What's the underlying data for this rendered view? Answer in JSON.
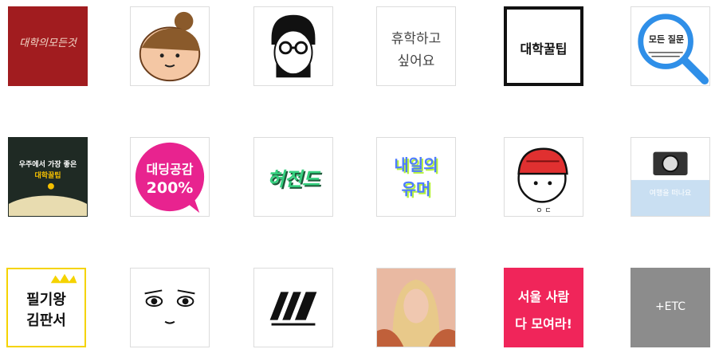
{
  "tiles": [
    {
      "id": "book-red",
      "text": "대학의모든것"
    },
    {
      "id": "bun-girl",
      "text": ""
    },
    {
      "id": "glasses-man",
      "text": ""
    },
    {
      "id": "leave-school",
      "text": "휴학하고\n싶어요"
    },
    {
      "id": "univ-tips",
      "text": "대학꿀팁"
    },
    {
      "id": "magnifier",
      "text": "모든 질문"
    },
    {
      "id": "space-campus",
      "line1": "우주에서 가장 좋은",
      "line2": "대학꿀팁"
    },
    {
      "id": "empathy",
      "line1": "대딩공감",
      "line2": "200%"
    },
    {
      "id": "hur-jeon-d",
      "text": "허전드"
    },
    {
      "id": "tomorrow-humor",
      "line1": "내일의",
      "line2": "유머"
    },
    {
      "id": "beanie-face",
      "text": "ㅇ ㄷ"
    },
    {
      "id": "camera",
      "text": "여행을 떠나요"
    },
    {
      "id": "pilgi-king",
      "line1": "필기왕",
      "line2": "김판서"
    },
    {
      "id": "funny-eyes",
      "text": ""
    },
    {
      "id": "stripes-logo",
      "text": ""
    },
    {
      "id": "blonde-photo",
      "text": ""
    },
    {
      "id": "seoul-people",
      "line1": "서울 사람",
      "line2": "다 모여라!"
    },
    {
      "id": "etc",
      "text": "+ETC"
    }
  ],
  "colors": {
    "red": "#a11c1f",
    "magenta": "#e8238f",
    "blue": "#2f8fe8",
    "pink": "#f0255a",
    "gray": "#8c8c8c",
    "dark": "#1a1a1a",
    "yellow": "#f5d300"
  }
}
